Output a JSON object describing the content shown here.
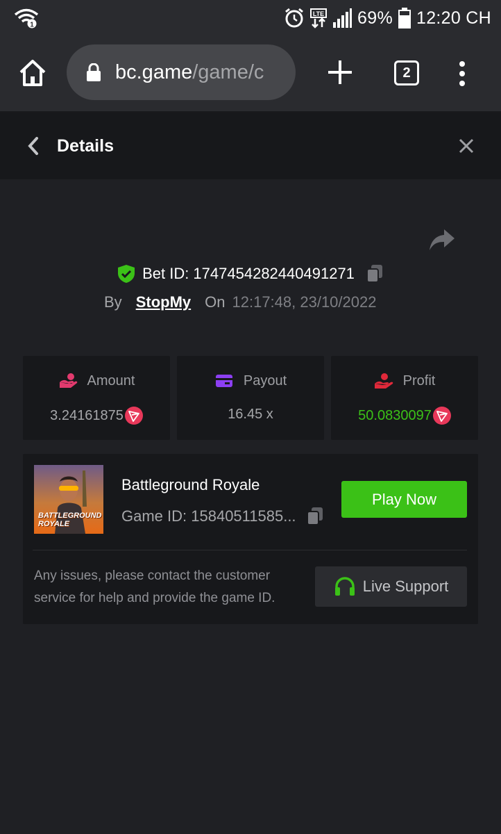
{
  "status_bar": {
    "battery": "69%",
    "time": "12:20 CH",
    "icons": [
      "wifi-icon",
      "alarm-icon",
      "lte-icon",
      "signal-icon",
      "battery-icon"
    ]
  },
  "browser": {
    "url_host": "bc.game",
    "url_path": "/game/c",
    "tab_count": "2"
  },
  "header": {
    "title": "Details"
  },
  "bet": {
    "id_label": "Bet ID: 1747454282440491271",
    "by_label": "By",
    "user": "StopMy",
    "on_label": "On",
    "time": "12:17:48, 23/10/2022"
  },
  "stats": [
    {
      "label": "Amount",
      "value": "3.24161875",
      "icon": "amount-icon",
      "color": "#e23a6e"
    },
    {
      "label": "Payout",
      "value": "16.45 x",
      "icon": "payout-icon",
      "color": "#8c3ff2"
    },
    {
      "label": "Profit",
      "value": "50.0830097",
      "icon": "profit-icon",
      "color": "#e0293a"
    }
  ],
  "game": {
    "title": "Battleground Royale",
    "id_label": "Game ID: 15840511585...",
    "thumb_text_1": "BATTLEGROUND",
    "thumb_text_2": "ROYALE",
    "play_label": "Play Now",
    "issue_text": "Any issues, please contact the customer service for help and provide the game ID.",
    "support_label": "Live Support"
  },
  "colors": {
    "accent_green": "#3bc117",
    "background": "#1f2024",
    "card": "#17181b"
  }
}
